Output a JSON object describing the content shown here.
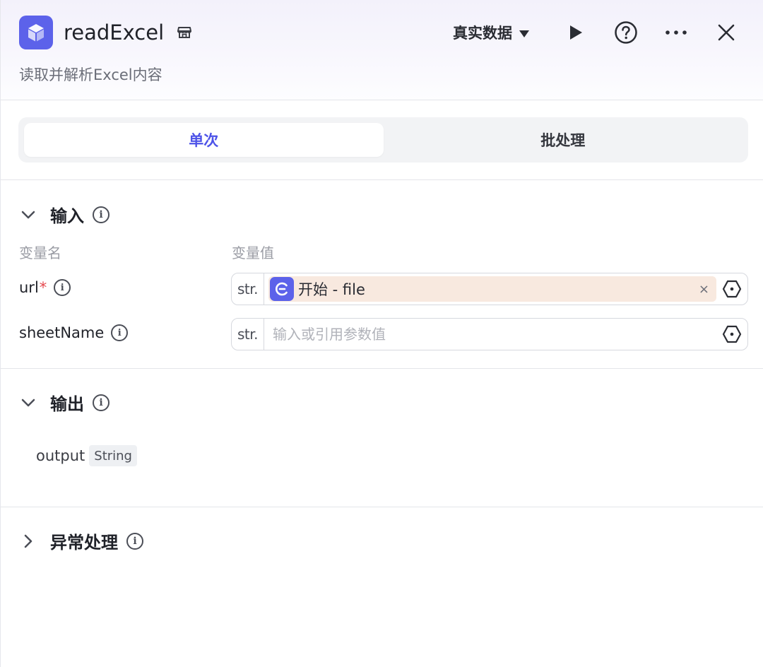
{
  "header": {
    "title": "readExcel",
    "description": "读取并解析Excel内容",
    "mode_label": "真实数据",
    "icons": [
      "cube-icon",
      "store-icon",
      "play-icon",
      "help-icon",
      "more-icon",
      "close-icon"
    ]
  },
  "tabs": [
    {
      "label": "单次",
      "active": true
    },
    {
      "label": "批处理",
      "active": false
    }
  ],
  "input": {
    "title": "输入",
    "col_name": "变量名",
    "col_value": "变量值",
    "params": [
      {
        "name": "url",
        "required_mark": "*",
        "type": "str.",
        "ref": "开始 - file",
        "clear": "×"
      },
      {
        "name": "sheetName",
        "type": "str.",
        "placeholder": "输入或引用参数值"
      }
    ]
  },
  "output": {
    "title": "输出",
    "items": [
      {
        "name": "output",
        "type": "String"
      }
    ]
  },
  "error_handling": {
    "title": "异常处理"
  },
  "colors": {
    "accent": "#4d53e8",
    "icon_bg": "#5c62ea",
    "ref_chip_bg": "#f8e9df",
    "required": "#e5484d"
  }
}
